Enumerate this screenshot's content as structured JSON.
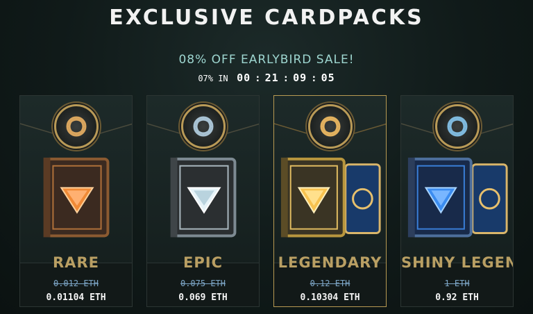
{
  "header": {
    "title": "EXCLUSIVE CARDPACKS",
    "sale_text": "08% OFF EARLYBIRD SALE!",
    "countdown": {
      "prefix": "07% IN",
      "hours": "00",
      "minutes": "21",
      "seconds": "09",
      "extra": "05"
    }
  },
  "packs": [
    {
      "name": "RARE",
      "old_price": "0.012 ETH",
      "new_price": "0.01104 ETH",
      "accent": "#e8772a",
      "icon": "knot-emblem-icon"
    },
    {
      "name": "EPIC",
      "old_price": "0.075 ETH",
      "new_price": "0.069 ETH",
      "accent": "#cfe3ec",
      "icon": "knot-emblem-icon"
    },
    {
      "name": "LEGENDARY",
      "old_price": "0.12 ETH",
      "new_price": "0.10304 ETH",
      "accent": "#f0b545",
      "icon": "knot-emblem-icon"
    },
    {
      "name": "SHINY LEGENDAR",
      "old_price": "1 ETH",
      "new_price": "0.92 ETH",
      "accent": "#3a8be8",
      "icon": "knot-emblem-icon"
    }
  ],
  "colors": {
    "gold": "#b99f63",
    "frame_gold": "#b89a52",
    "old_price": "#7ea7c8",
    "sale_teal": "#9ed6d0"
  }
}
